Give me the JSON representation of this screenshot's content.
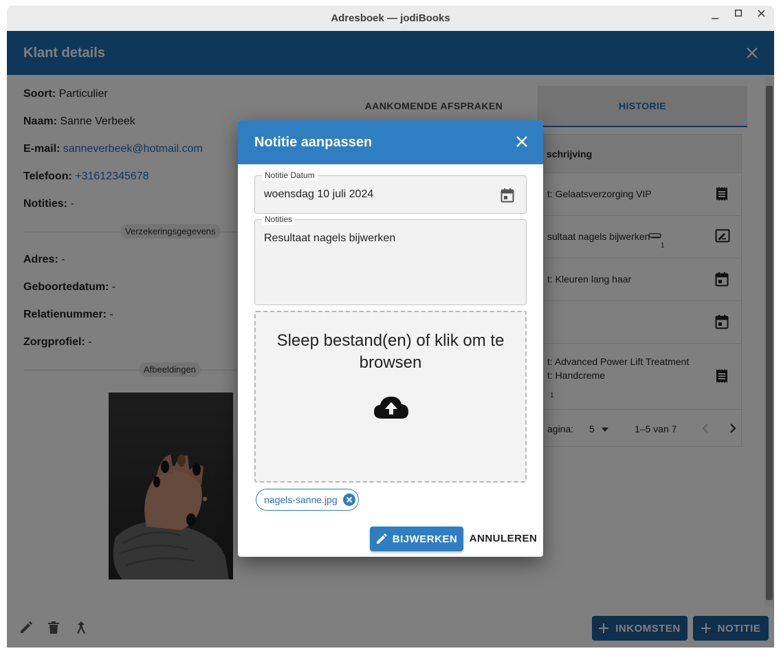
{
  "window": {
    "title": "Adresboek — jodiBooks",
    "controls": {
      "minimize": "–",
      "maximize": "☐",
      "close": "✕"
    }
  },
  "appbar": {
    "title": "Klant details"
  },
  "client": {
    "type_label": "Soort:",
    "type_value": "Particulier",
    "name_label": "Naam:",
    "name_value": "Sanne Verbeek",
    "email_label": "E-mail:",
    "email_value": "sanneverbeek@hotmail.com",
    "phone_label": "Telefoon:",
    "phone_value": "+31612345678",
    "notes_label": "Notities:",
    "notes_value": "-",
    "insurance_section": "Verzekeringsgegevens",
    "address_label": "Adres:",
    "address_value": "-",
    "birthdate_label": "Geboortedatum:",
    "birthdate_value": "-",
    "relation_label": "Relatienummer:",
    "relation_value": "-",
    "careprofile_label": "Zorgprofiel:",
    "careprofile_value": "-",
    "images_section": "Afbeeldingen"
  },
  "tabs": [
    {
      "label": "AANKOMENDE AFSPRAKEN",
      "active": false
    },
    {
      "label": "HISTORIE",
      "active": true
    }
  ],
  "history_table": {
    "header": "schrijving",
    "rows": [
      {
        "line1": "t: Gelaatsverzorging VIP",
        "line2": "",
        "icon": "receipt-icon"
      },
      {
        "line1": "sultaat nagels bijwerken",
        "line2": "",
        "icon": "note-edit-icon",
        "attachments": "1"
      },
      {
        "line1": "t: Kleuren lang haar",
        "line2": "",
        "icon": "calendar-icon"
      },
      {
        "line1": "",
        "line2": "",
        "icon": "calendar-icon"
      },
      {
        "line1": "t: Advanced Power Lift Treatment",
        "line2": "t: Handcreme",
        "icon": "receipt-icon",
        "attachments": "1"
      }
    ],
    "pagination": {
      "rows_label": "agina:",
      "rows_value": "5",
      "range": "1–5 van 7"
    }
  },
  "bottom_actions": {
    "income_label": "INKOMSTEN",
    "note_label": "NOTITIE"
  },
  "dialog": {
    "title": "Notitie aanpassen",
    "date_label": "Notitie Datum",
    "date_value": "woensdag 10 juli 2024",
    "notes_label": "Notities",
    "notes_value": "Resultaat nagels bijwerken",
    "dropzone_text": "Sleep bestand(en) of klik om te browsen",
    "file_name": "nagels-sanne.jpg",
    "update_label": "BIJWERKEN",
    "cancel_label": "ANNULEREN"
  },
  "colors": {
    "appbar": "#1e6fb5",
    "dialog_header": "#2f7ec1",
    "link": "#1f6fba",
    "button_primary": "#2f7ec1"
  }
}
